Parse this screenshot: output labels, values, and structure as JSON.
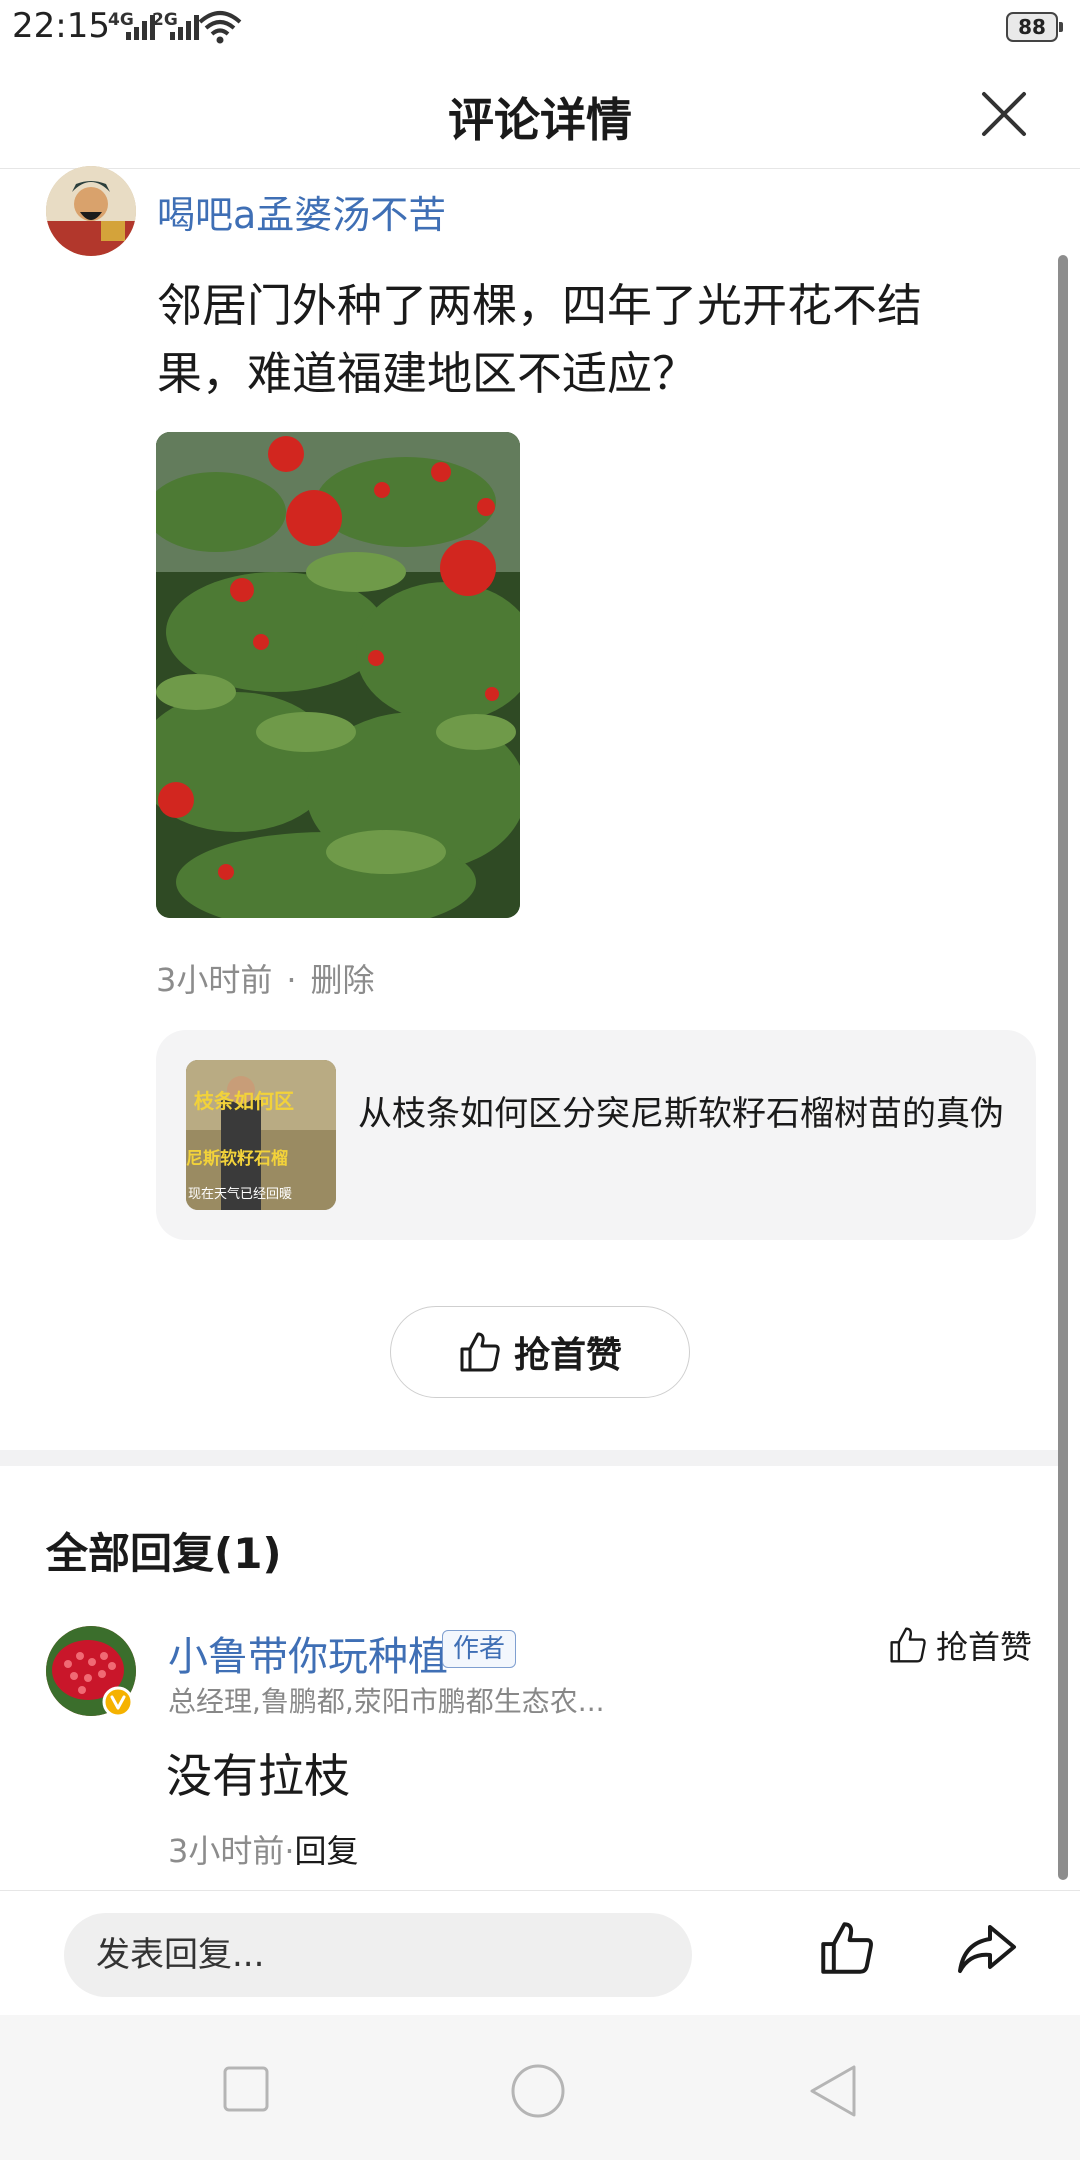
{
  "status_bar": {
    "time": "22:15",
    "signal1": "4G",
    "signal2": "2G",
    "battery": "88"
  },
  "header": {
    "title": "评论详情"
  },
  "post": {
    "username": "喝吧a孟婆汤不苦",
    "text": "邻居门外种了两棵，四年了光开花不结果，难道福建地区不适应？",
    "time": "3小时前",
    "delete_label": "删除",
    "linked_video": {
      "title": "从枝条如何区分突尼斯软籽石榴树苗的真伪",
      "thumb_text": "枝条如何区",
      "thumb_text2": "尼斯软籽石榴",
      "thumb_caption": "现在天气已经回暖"
    },
    "like_first_label": "抢首赞"
  },
  "replies": {
    "heading": "全部回复(1)",
    "items": [
      {
        "name": "小鲁带你玩种植",
        "badge": "作者",
        "subtitle": "总经理,鲁鹏都,荥阳市鹏都生态农...",
        "text": "没有拉枝",
        "time": "3小时前",
        "reply_label": "回复",
        "like_label": "抢首赞"
      }
    ]
  },
  "bottom_bar": {
    "reply_placeholder": "发表回复..."
  },
  "colors": {
    "link_blue": "#3f6fb5",
    "meta_gray": "#8c8c8c"
  }
}
